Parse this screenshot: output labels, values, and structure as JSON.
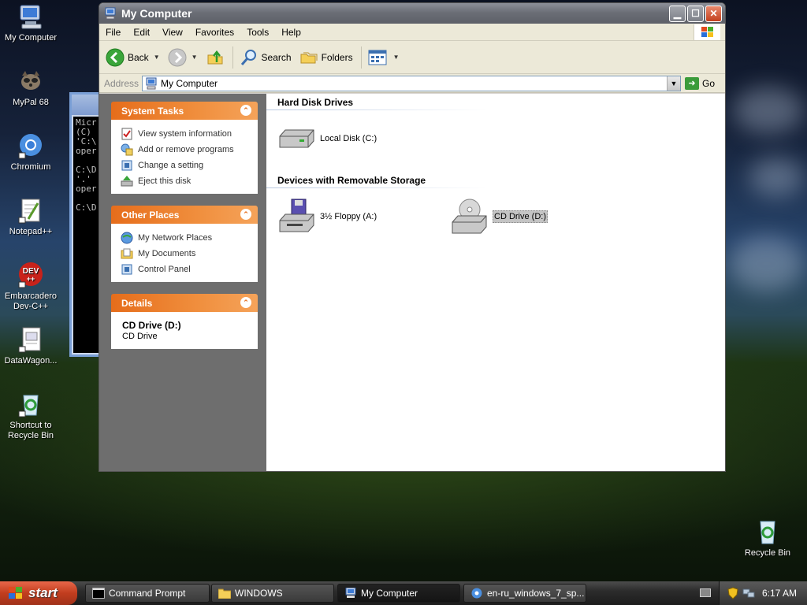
{
  "desktop": {
    "icons": [
      {
        "label": "My Computer"
      },
      {
        "label": "MyPal 68"
      },
      {
        "label": "Chromium"
      },
      {
        "label": "Notepad++"
      },
      {
        "label": "Embarcadero Dev-C++"
      },
      {
        "label": "DataWagon..."
      },
      {
        "label": "Shortcut to Recycle Bin"
      },
      {
        "label": "Recycle Bin"
      }
    ]
  },
  "console": {
    "lines": [
      "Micr",
      "(C)",
      "'C:\\",
      "oper",
      "",
      "C:\\D",
      "'.'",
      "oper",
      "",
      "C:\\D"
    ]
  },
  "window": {
    "title": "My Computer",
    "menu": [
      "File",
      "Edit",
      "View",
      "Favorites",
      "Tools",
      "Help"
    ],
    "toolbar": {
      "back": "Back",
      "search": "Search",
      "folders": "Folders"
    },
    "address": {
      "label": "Address",
      "value": "My Computer",
      "go": "Go"
    },
    "tasks": {
      "system_title": "System Tasks",
      "system_items": [
        "View system information",
        "Add or remove programs",
        "Change a setting",
        "Eject this disk"
      ],
      "other_title": "Other Places",
      "other_items": [
        "My Network Places",
        "My Documents",
        "Control Panel"
      ],
      "details_title": "Details",
      "details_name": "CD Drive (D:)",
      "details_type": "CD Drive"
    },
    "groups": {
      "hdd_title": "Hard Disk Drives",
      "removable_title": "Devices with Removable Storage"
    },
    "drives": {
      "local": "Local Disk (C:)",
      "floppy": "3½ Floppy (A:)",
      "cd": "CD Drive (D:)"
    }
  },
  "taskbar": {
    "start": "start",
    "tasks": [
      "Command Prompt",
      "WINDOWS",
      "My Computer",
      "en-ru_windows_7_sp..."
    ],
    "clock": "6:17 AM"
  },
  "colors": {
    "taskpane_header": "#e66d1b",
    "start_button": "#c13d1e",
    "taskpane_bg": "#6e6e6e"
  }
}
